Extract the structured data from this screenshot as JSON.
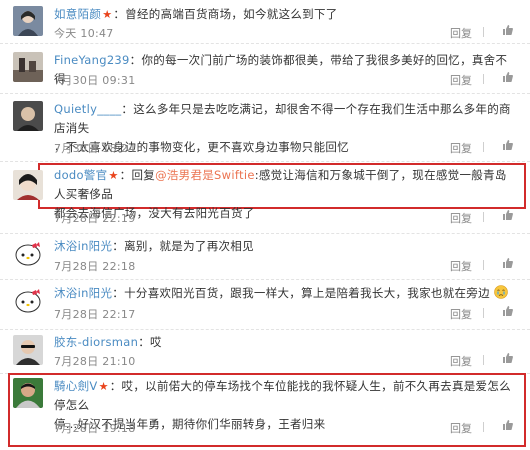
{
  "reply_label": "回复",
  "comments": [
    {
      "user": "如意陌颜",
      "vip": true,
      "text": "：曾经的高端百货商场，如今就这么到下了",
      "time": "今天 10:47"
    },
    {
      "user": "FineYang239",
      "vip": false,
      "text": "：你的每一次门前广场的装饰都很美，带给了我很多美好的回忆，真舍不得",
      "time": "7月30日 09:31"
    },
    {
      "user": "Quietly____",
      "vip": false,
      "text_line1": "：这么多年只是去吃吃满记，却很舍不得一个存在我们生活中那么多年的商店消失",
      "text_line2": "，不太喜欢身边的事物变化，更不喜欢身边事物只能回忆",
      "time": "7月30日 18:24"
    },
    {
      "user": "dodo警官",
      "vip": true,
      "reply_prefix": "：回复",
      "mention": "@浩男君是Swiftie",
      "text_line1": ":感觉让海信和万象城干倒了，现在感觉一般青岛人买奢侈品",
      "text_line2": "都会去海信广场，没大有去阳光百货了",
      "time": "7月28日 22:19"
    },
    {
      "user": "沐浴in阳光",
      "vip": false,
      "text": "：离别，就是为了再次相见",
      "time": "7月28日 22:18"
    },
    {
      "user": "沐浴in阳光",
      "vip": false,
      "text": "：十分喜欢阳光百货，跟我一样大，算上是陪着我长大，我家也就在旁边",
      "time": "7月28日 22:17"
    },
    {
      "user": "胶东-diorsman",
      "vip": false,
      "text": "：哎",
      "time": "7月28日 21:10"
    },
    {
      "user": "騎心劍V",
      "vip": true,
      "text_line1": "：哎，以前偌大的停车场找个车位能找的我怀疑人生，前不久再去真是爱怎么停怎么",
      "text_line2": "停…好汉不提当年勇，期待你们华丽转身，王者归来",
      "time": "7月28日 19:18"
    }
  ],
  "colors": {
    "username": "#eb7350",
    "highlight_box": "#d22b2b",
    "meta": "#888888"
  }
}
